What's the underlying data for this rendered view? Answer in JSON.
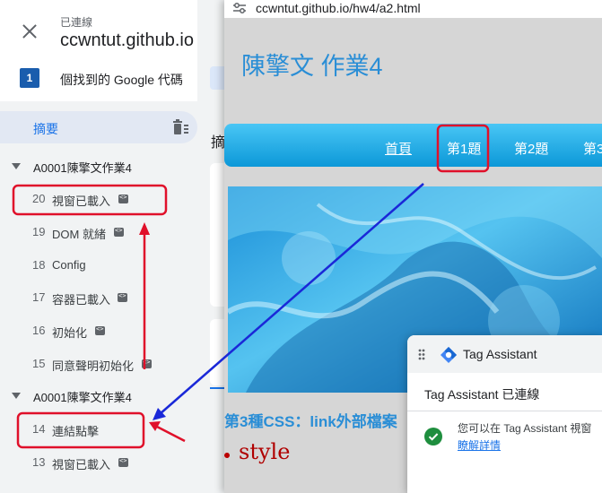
{
  "colors": {
    "accent": "#1a73e8",
    "nav_blue": "#0c98d8",
    "title_blue": "#2a8ed6",
    "annotation_red": "#e0102a",
    "annotation_arrow_blue": "#1a28d8",
    "check_green": "#1e8e3e"
  },
  "tag_assistant": {
    "status": "已連線",
    "domain": "ccwntut.github.io",
    "tag_count": "1",
    "tag_count_label": "個找到的 Google 代碼",
    "summary_label": "摘要",
    "icons": {
      "close": "close-icon",
      "trash": "trash-icon",
      "code": "code-icon"
    },
    "groups": [
      {
        "label": "A0001陳擎文作業4",
        "events": [
          {
            "num": "20",
            "name": "視窗已載入",
            "has_code": true,
            "highlighted": true
          },
          {
            "num": "19",
            "name": "DOM 就緒",
            "has_code": true
          },
          {
            "num": "18",
            "name": "Config",
            "has_code": false
          },
          {
            "num": "17",
            "name": "容器已載入",
            "has_code": true
          },
          {
            "num": "16",
            "name": "初始化",
            "has_code": true
          },
          {
            "num": "15",
            "name": "同意聲明初始化",
            "has_code": true
          }
        ]
      },
      {
        "label": "A0001陳擎文作業4",
        "events": [
          {
            "num": "14",
            "name": "連結點擊",
            "has_code": false,
            "highlighted": true
          },
          {
            "num": "13",
            "name": "視窗已載入",
            "has_code": true
          }
        ]
      }
    ],
    "middle_partial_text": "摘"
  },
  "browser": {
    "url": "ccwntut.github.io/hw4/a2.html",
    "page_title": "陳擎文 作業4",
    "nav_links": [
      "首頁",
      "第1題",
      "第2題",
      "第3"
    ],
    "section_heading": "第3種CSS：link外部檔案",
    "style_word": "style"
  },
  "popup": {
    "title": "Tag Assistant",
    "status": "Tag Assistant 已連線",
    "message": "您可以在 Tag Assistant 視窗",
    "link": "瞭解詳情"
  }
}
